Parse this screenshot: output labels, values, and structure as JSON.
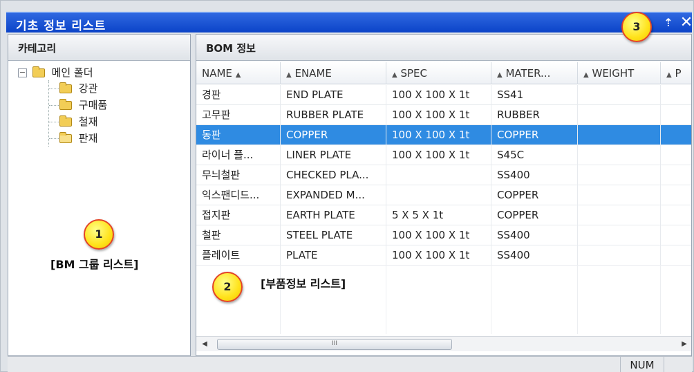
{
  "window": {
    "title": "기초 정보 리스트",
    "pin_glyph": "⇡",
    "close_glyph": "✕"
  },
  "left_panel": {
    "header": "카테고리",
    "tree": {
      "root": {
        "label": "메인 폴더",
        "expander": "−"
      },
      "children": [
        "강관",
        "구매품",
        "철재",
        "판재"
      ]
    }
  },
  "right_panel": {
    "header": "BOM 정보",
    "columns": [
      "NAME",
      "ENAME",
      "SPEC",
      "MATER...",
      "WEIGHT",
      "P"
    ],
    "sort_glyph": "▲",
    "rows": [
      {
        "name": "경판",
        "ename": "END PLATE",
        "spec": "100 X 100 X 1t",
        "material": "SS41"
      },
      {
        "name": "고무판",
        "ename": "RUBBER PLATE",
        "spec": "100 X 100 X 1t",
        "material": "RUBBER"
      },
      {
        "name": "동판",
        "ename": "COPPER",
        "spec": "100 X 100 X 1t",
        "material": "COPPER"
      },
      {
        "name": "라이너 플...",
        "ename": "LINER PLATE",
        "spec": "100 X 100 X 1t",
        "material": "S45C"
      },
      {
        "name": "무늬철판",
        "ename": "CHECKED PLA...",
        "spec": "",
        "material": "SS400"
      },
      {
        "name": "익스팬디드...",
        "ename": "EXPANDED M...",
        "spec": "",
        "material": "COPPER"
      },
      {
        "name": "접지판",
        "ename": "EARTH PLATE",
        "spec": "5 X 5 X 1t",
        "material": "COPPER"
      },
      {
        "name": "철판",
        "ename": "STEEL PLATE",
        "spec": "100 X 100 X 1t",
        "material": "SS400"
      },
      {
        "name": "플레이트",
        "ename": "PLATE",
        "spec": "100 X 100 X 1t",
        "material": "SS400"
      }
    ],
    "selected_row": 2,
    "scrollbar": {
      "left_arrow": "◀",
      "right_arrow": "▶",
      "thumb_grip": "III"
    }
  },
  "statusbar": {
    "panel": "NUM"
  },
  "annotations": [
    {
      "number": "1",
      "label": "[BM 그룹 리스트]"
    },
    {
      "number": "2",
      "label": "[부품정보 리스트]"
    },
    {
      "number": "3"
    }
  ],
  "colors": {
    "titlebar": "#0b43c8",
    "selection": "#2f8be2",
    "badge_fill": "#ffe21a",
    "badge_border": "#e34428"
  }
}
